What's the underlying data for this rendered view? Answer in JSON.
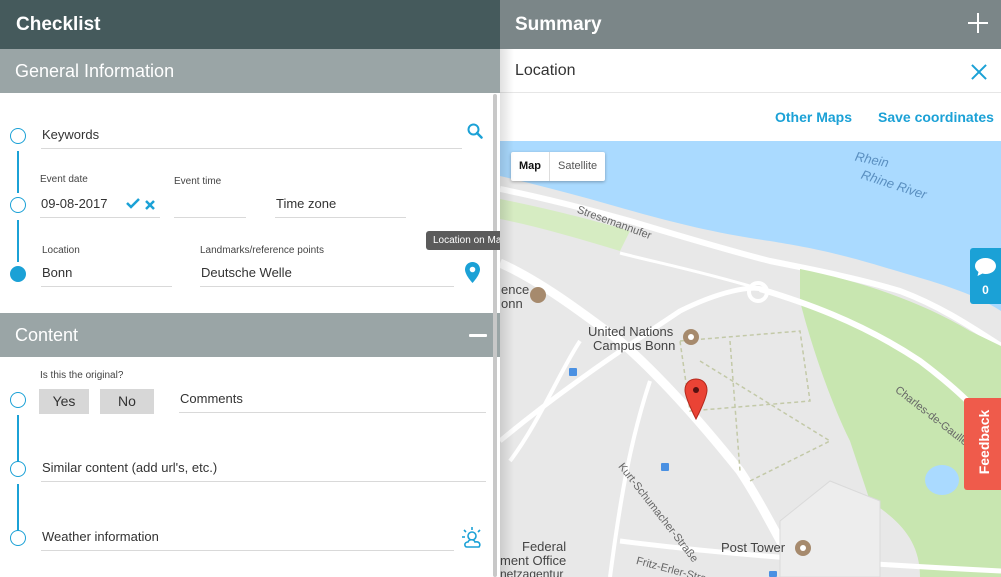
{
  "checklist": {
    "title": "Checklist",
    "general": {
      "title": "General Information",
      "keywords_label": "Keywords",
      "event_date_label": "Event date",
      "event_date_value": "09-08-2017",
      "event_time_label": "Event time",
      "event_time_value": "",
      "time_zone_label": "Time zone",
      "location_label": "Location",
      "location_value": "Bonn",
      "landmarks_label": "Landmarks/reference points",
      "landmarks_value": "Deutsche Welle",
      "tooltip": "Location on Maps"
    },
    "content": {
      "title": "Content",
      "original_label": "Is this the original?",
      "yes_label": "Yes",
      "no_label": "No",
      "comments_label": "Comments",
      "similar_label": "Similar content (add url's, etc.)",
      "weather_label": "Weather information"
    }
  },
  "summary": {
    "title": "Summary",
    "location_title": "Location",
    "other_maps": "Other Maps",
    "save_coordinates": "Save coordinates",
    "map": {
      "map_btn": "Map",
      "satellite_btn": "Satellite",
      "labels": {
        "rhein": "Rhein",
        "rhine_river": "Rhine River",
        "stresemannufer": "Stresemannufer",
        "un_line1": "United Nations",
        "un_line2": "Campus Bonn",
        "kurt": "Kurt-Schumacher-Straße",
        "charles": "Charles-de-Gaulle",
        "federal_line1": "Federal",
        "federal_line2": "ment Office",
        "federal_line3": "netzagentur",
        "post_tower": "Post Tower",
        "fritz": "Fritz-Erler-Stra",
        "ence": "ence",
        "onn": "onn"
      }
    }
  },
  "side_tabs": {
    "comments_count": "0",
    "feedback": "Feedback"
  },
  "colors": {
    "accent": "#1ba1d6",
    "header_dark": "#455a5c",
    "header_grey": "#9aa5a6",
    "feedback": "#ef5b4b",
    "water": "#aadaff",
    "park": "#c8e6b0"
  }
}
